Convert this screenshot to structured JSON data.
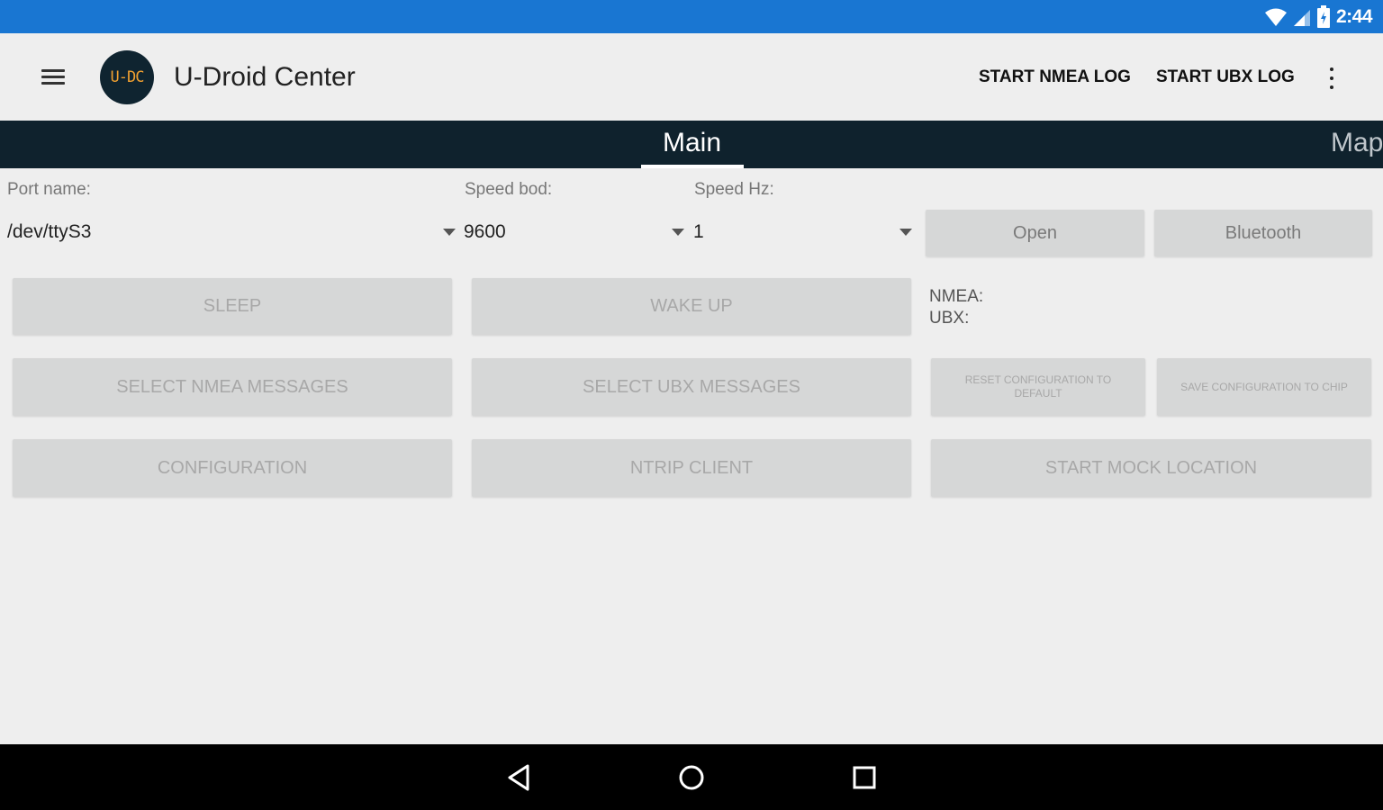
{
  "status_bar": {
    "time": "2:44",
    "icons": [
      "wifi-icon",
      "signal-icon",
      "battery-icon"
    ],
    "color": "#1976d2"
  },
  "app_bar": {
    "menu_icon": "hamburger-menu-icon",
    "logo_text": "U-DC",
    "title": "U-Droid Center",
    "actions": [
      "START NMEA LOG",
      "START UBX LOG"
    ],
    "overflow_icon": "more-vert-icon"
  },
  "tabs": [
    {
      "label": "Main",
      "selected": true
    },
    {
      "label": "Map",
      "selected": false
    }
  ],
  "form": {
    "port_label": "Port name:",
    "port_value": "/dev/ttyS3",
    "speed_bod_label": "Speed bod:",
    "speed_bod_value": "9600",
    "speed_hz_label": "Speed Hz:",
    "speed_hz_value": "1"
  },
  "buttons": {
    "open": "Open",
    "bluetooth": "Bluetooth",
    "sleep": "SLEEP",
    "wake_up": "WAKE UP",
    "select_nmea": "SELECT NMEA MESSAGES",
    "select_ubx": "SELECT UBX MESSAGES",
    "reset_config": "RESET CONFIGURATION TO DEFAULT",
    "save_config": "SAVE CONFIGURATION TO CHIP",
    "configuration": "CONFIGURATION",
    "ntrip_client": "NTRIP CLIENT",
    "start_mock": "START MOCK LOCATION"
  },
  "info": {
    "nmea": "NMEA:",
    "ubx": "UBX:"
  },
  "nav_bar": {
    "icons": [
      "back-icon",
      "home-icon",
      "recents-icon"
    ]
  },
  "colors": {
    "status_bar": "#1976d2",
    "tab_bar": "#0f222d",
    "logo_bg": "#0f2430",
    "logo_text": "#f0a030",
    "background": "#eeeeee",
    "button": "#d6d7d7"
  }
}
